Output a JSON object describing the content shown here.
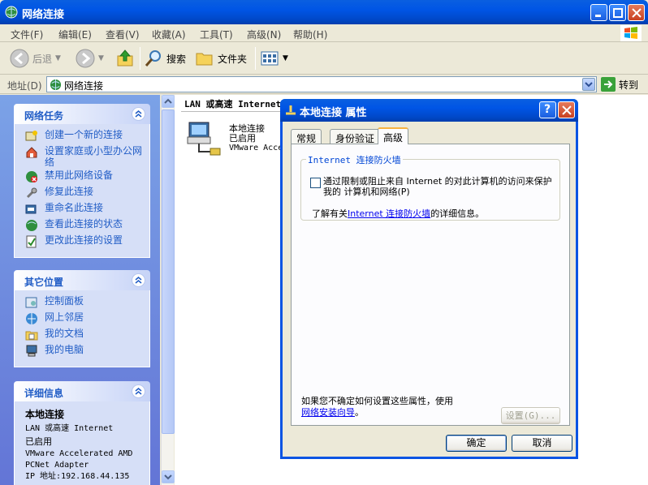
{
  "window": {
    "title": "网络连接"
  },
  "menu": [
    "文件(F)",
    "编辑(E)",
    "查看(V)",
    "收藏(A)",
    "工具(T)",
    "高级(N)",
    "帮助(H)"
  ],
  "toolbar": {
    "back": "后退",
    "search": "搜索",
    "folders": "文件夹"
  },
  "address": {
    "label": "地址(D)",
    "value": "网络连接",
    "go": "转到"
  },
  "tasks": {
    "network": {
      "title": "网络任务",
      "items": [
        "创建一个新的连接",
        "设置家庭或小型办公网络",
        "禁用此网络设备",
        "修复此连接",
        "重命名此连接",
        "查看此连接的状态",
        "更改此连接的设置"
      ]
    },
    "other": {
      "title": "其它位置",
      "items": [
        "控制面板",
        "网上邻居",
        "我的文档",
        "我的电脑"
      ]
    },
    "details": {
      "title": "详细信息",
      "name": "本地连接",
      "type": "LAN 或高速 Internet",
      "status": "已启用",
      "adapter": "VMware Accelerated AMD PCNet Adapter",
      "ip": "IP 地址:192.168.44.135"
    }
  },
  "content": {
    "group_header": "LAN 或高速 Internet",
    "item": {
      "name": "本地连接",
      "status": "已启用",
      "adapter": "VMware Acce"
    }
  },
  "dialog": {
    "title": "本地连接 属性",
    "tabs": [
      "常规",
      "身份验证",
      "高级"
    ],
    "active_tab": 2,
    "group_title": "Internet 连接防火墙",
    "checkbox_label": "通过限制或阻止来自 Internet 的对此计算机的访问来保护我的 计算机和网络(P)",
    "checkbox_checked": false,
    "info_prefix": "了解有关",
    "info_link": "Internet 连接防火墙",
    "info_suffix": "的详细信息。",
    "bottom_text": "如果您不确定如何设置这些属性，使用",
    "bottom_link": "网络安装向导",
    "bottom_suffix": "。",
    "settings_button": "设置(G)...",
    "ok_button": "确定",
    "cancel_button": "取消"
  },
  "colors": {
    "title_blue": "#0055e5",
    "panel_blue": "#6375d6",
    "link_blue": "#215dc6"
  }
}
